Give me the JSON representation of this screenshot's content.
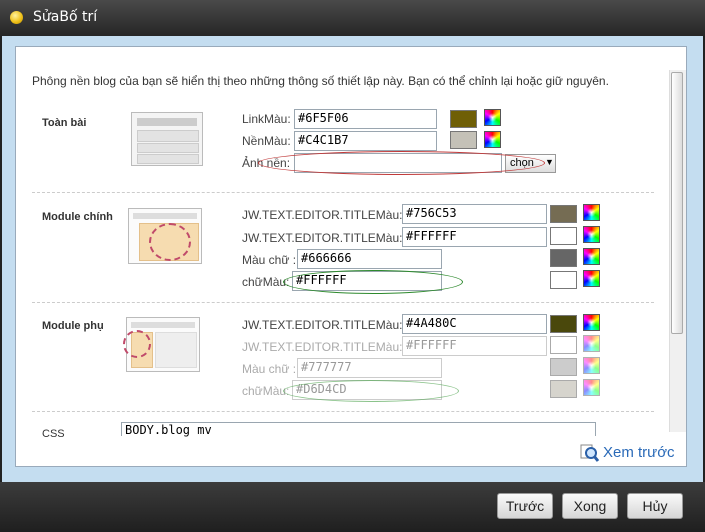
{
  "window": {
    "title": "SửaBố trí"
  },
  "description": "Phông nền blog của bạn sẽ hiển thị theo những thông số thiết lập này. Bạn có thể chỉnh lại hoặc giữ nguyên.",
  "sections": {
    "toan_bai": {
      "label": "Toàn bài",
      "link_label": "LinkMàu:",
      "link_value": "#6F5F06",
      "link_color": "#6F5F06",
      "bg_label": "NềnMàu:",
      "bg_value": "#C4C1B7",
      "bg_color": "#C4C1B7",
      "image_label": "Ảnh nền:",
      "choose_label": "chọn"
    },
    "module_chinh": {
      "label": "Module chính",
      "title_label": "JW.TEXT.EDITOR.TITLEMàu:",
      "title_value": "#756C53",
      "title_color": "#756C53",
      "title2_label": "JW.TEXT.EDITOR.TITLEMàu:",
      "title2_value": "#FFFFFF",
      "title2_color": "#FFFFFF",
      "text_label": "Màu chữ :",
      "text_value": "#666666",
      "text_color": "#666666",
      "chu_label": "chữMàu:",
      "chu_value": "#FFFFFF",
      "chu_color": "#FFFFFF"
    },
    "module_phu": {
      "label": "Module phụ",
      "title_label": "JW.TEXT.EDITOR.TITLEMàu:",
      "title_value": "#4A480C",
      "title_color": "#4A480C",
      "title2_label": "JW.TEXT.EDITOR.TITLEMàu:",
      "title2_value": "#FFFFFF",
      "title2_color": "#FFFFFF",
      "text_label": "Màu chữ :",
      "text_value": "#777777",
      "text_color": "#CCCCCC",
      "chu_label": "chữMàu:",
      "chu_value": "#D6D4CD",
      "chu_color": "#D6D4CD"
    },
    "css": {
      "label": "CSS",
      "value": "BODY.blog mv"
    }
  },
  "preview": {
    "label": "Xem trước",
    "icon": "magnifier-icon"
  },
  "footer": {
    "back": "Trước",
    "done": "Xong",
    "cancel": "Hủy"
  }
}
